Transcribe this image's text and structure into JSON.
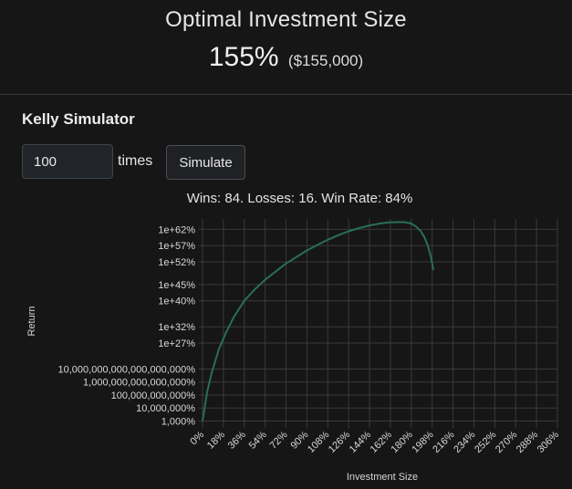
{
  "header": {
    "title": "Optimal Investment Size",
    "percent": "155%",
    "amount": "($155,000)"
  },
  "simulator": {
    "title": "Kelly Simulator",
    "times_value": "100",
    "times_label": "times",
    "simulate_label": "Simulate",
    "stats": "Wins: 84. Losses: 16. Win Rate: 84%"
  },
  "colors": {
    "background": "#161616",
    "curve": "#2a6f54",
    "grid": "#3a3a3a"
  },
  "chart_data": {
    "type": "line",
    "xlabel": "Investment Size",
    "ylabel": "Return",
    "x_ticks": [
      "0%",
      "18%",
      "36%",
      "54%",
      "72%",
      "90%",
      "108%",
      "126%",
      "144%",
      "162%",
      "180%",
      "198%",
      "216%",
      "234%",
      "252%",
      "270%",
      "288%",
      "306%"
    ],
    "y_ticks": [
      {
        "label": "1,000%",
        "log10": 1
      },
      {
        "label": "10,000,000%",
        "log10": 5
      },
      {
        "label": "100,000,000,000%",
        "log10": 9
      },
      {
        "label": "1,000,000,000,000,000%",
        "log10": 13
      },
      {
        "label": "10,000,000,000,000,000,000%",
        "log10": 17
      },
      {
        "label": "1e+27%",
        "log10": 25
      },
      {
        "label": "1e+32%",
        "log10": 30
      },
      {
        "label": "1e+40%",
        "log10": 38
      },
      {
        "label": "1e+45%",
        "log10": 43
      },
      {
        "label": "1e+52%",
        "log10": 50
      },
      {
        "label": "1e+57%",
        "log10": 55
      },
      {
        "label": "1e+62%",
        "log10": 60
      }
    ],
    "y_scale": "log",
    "grid": true,
    "series": [
      {
        "x": [
          0,
          4,
          8,
          14,
          20,
          27,
          36,
          45,
          54,
          63,
          72,
          81,
          90,
          99,
          108,
          117,
          126,
          135,
          144,
          153,
          160,
          165,
          170,
          175,
          180,
          184,
          188,
          191,
          194,
          197,
          199
        ],
        "y": [
          1,
          10,
          16,
          23,
          28,
          33,
          38,
          41.5,
          44.5,
          47,
          49.5,
          51.5,
          53.5,
          55.2,
          56.8,
          58.2,
          59.4,
          60.4,
          61.2,
          61.8,
          62.1,
          62.2,
          62.25,
          62.2,
          61.8,
          60.9,
          59.5,
          57.8,
          55.3,
          51.5,
          47.5
        ]
      }
    ]
  }
}
